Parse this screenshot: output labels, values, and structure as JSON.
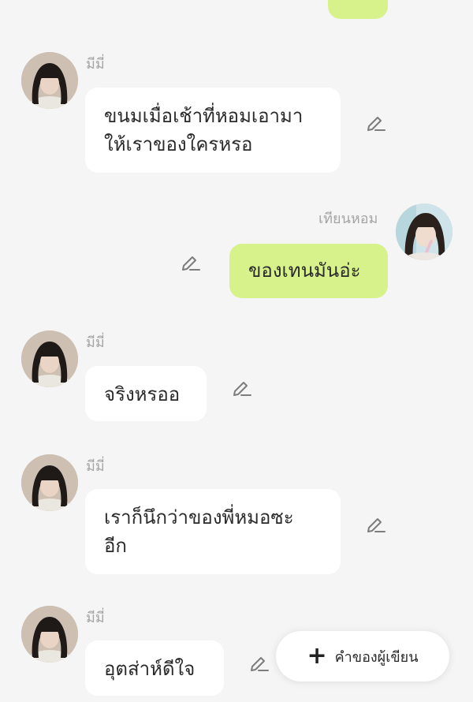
{
  "messages": [
    {
      "side": "right",
      "text": ""
    },
    {
      "side": "left",
      "sender": "มีมี่",
      "text": "ขนมเมื่อเช้าที่หอมเอามา\nให้เราของใครหรอ"
    },
    {
      "side": "right",
      "sender": "เทียนหอม",
      "text": "ของเทนมันอ่ะ"
    },
    {
      "side": "left",
      "sender": "มีมี่",
      "text": "จริงหรออ"
    },
    {
      "side": "left",
      "sender": "มีมี่",
      "text": "เราก็นึกว่าของพี่หมอซะ\nอีก"
    },
    {
      "side": "left",
      "sender": "มีมี่",
      "text": "อุตส่าห์ดีใจ"
    }
  ],
  "fab": {
    "icon": "plus-icon",
    "label": "คำของผู้เขียน"
  },
  "colors": {
    "background": "#f5f5f5",
    "left_bubble": "#ffffff",
    "right_bubble": "#d7f18b",
    "sender_name": "#a5a5a5",
    "text": "#2a2a2a"
  },
  "icons": {
    "edit": "pencil-edit-icon",
    "avatar": "avatar-photo"
  }
}
